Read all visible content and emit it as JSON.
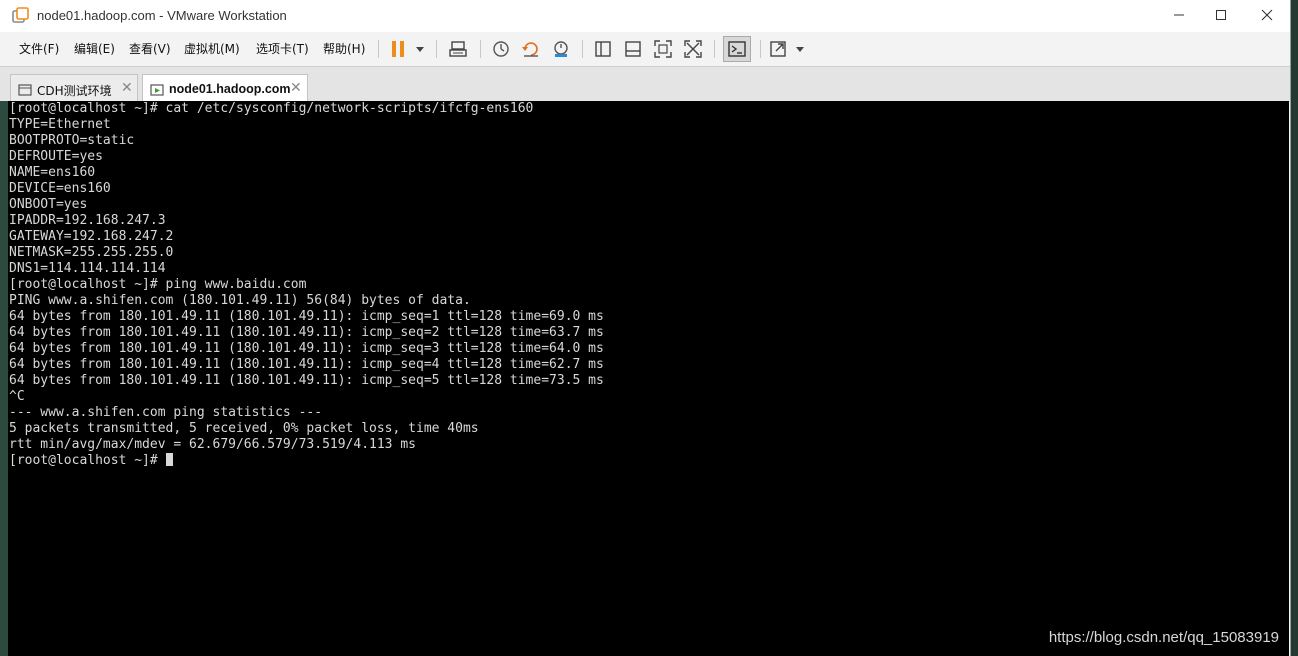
{
  "window": {
    "title": "node01.hadoop.com - VMware Workstation"
  },
  "menu": [
    {
      "label": "文件(F)"
    },
    {
      "label": "编辑(E)"
    },
    {
      "label": "查看(V)"
    },
    {
      "label": "虚拟机(M)"
    },
    {
      "label": "选项卡(T)"
    },
    {
      "label": "帮助(H)"
    }
  ],
  "toolbar": {
    "icons": [
      "pause-icon",
      "send-ctrl-alt-del-icon",
      "snapshot-icon",
      "revert-snapshot-icon",
      "snapshot-manager-icon",
      "library-icon",
      "thumbnail-bar-icon",
      "fullscreen-icon",
      "unity-icon",
      "console-view-icon",
      "stretch-icon"
    ],
    "accent_color": "#f08c1e"
  },
  "tabs": [
    {
      "label": "CDH测试环境",
      "active": false
    },
    {
      "label": "node01.hadoop.com",
      "active": true
    }
  ],
  "console": {
    "lines": [
      "[root@localhost ~]# cat /etc/sysconfig/network-scripts/ifcfg-ens160",
      "TYPE=Ethernet",
      "BOOTPROTO=static",
      "DEFROUTE=yes",
      "NAME=ens160",
      "DEVICE=ens160",
      "ONBOOT=yes",
      "IPADDR=192.168.247.3",
      "GATEWAY=192.168.247.2",
      "NETMASK=255.255.255.0",
      "DNS1=114.114.114.114",
      "[root@localhost ~]# ping www.baidu.com",
      "PING www.a.shifen.com (180.101.49.11) 56(84) bytes of data.",
      "64 bytes from 180.101.49.11 (180.101.49.11): icmp_seq=1 ttl=128 time=69.0 ms",
      "64 bytes from 180.101.49.11 (180.101.49.11): icmp_seq=2 ttl=128 time=63.7 ms",
      "64 bytes from 180.101.49.11 (180.101.49.11): icmp_seq=3 ttl=128 time=64.0 ms",
      "64 bytes from 180.101.49.11 (180.101.49.11): icmp_seq=4 ttl=128 time=62.7 ms",
      "64 bytes from 180.101.49.11 (180.101.49.11): icmp_seq=5 ttl=128 time=73.5 ms",
      "^C",
      "--- www.a.shifen.com ping statistics ---",
      "5 packets transmitted, 5 received, 0% packet loss, time 40ms",
      "rtt min/avg/max/mdev = 62.679/66.579/73.519/4.113 ms"
    ],
    "prompt": "[root@localhost ~]# ",
    "background": "#000000",
    "foreground": "#d8d8d8"
  },
  "watermark": "https://blog.csdn.net/qq_15083919"
}
